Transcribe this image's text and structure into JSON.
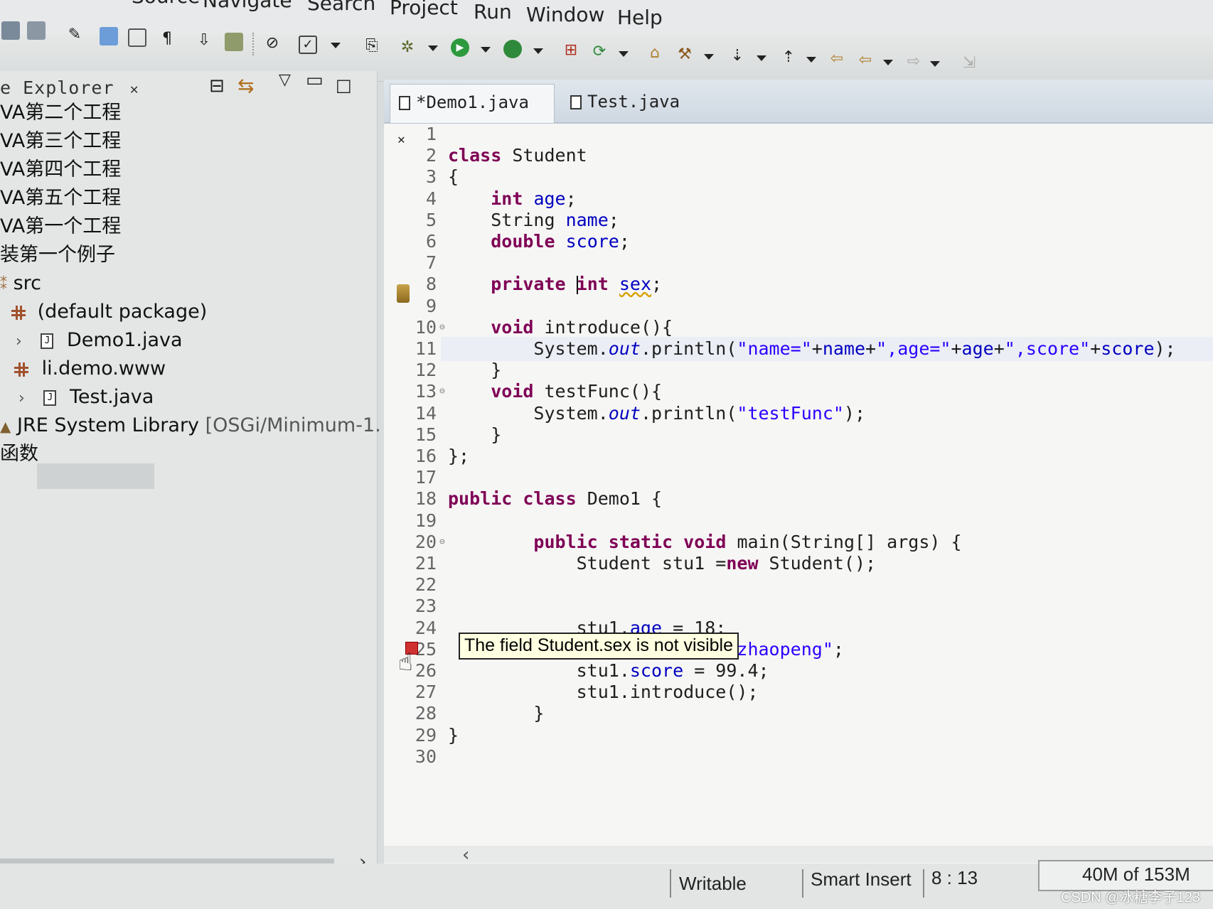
{
  "menu": {
    "items": [
      "Source",
      "Navigate",
      "Search",
      "Project",
      "Run",
      "Window",
      "Help"
    ]
  },
  "explorer": {
    "title": "e Explorer",
    "close_glyph": "✕",
    "tree": [
      {
        "label": "VA第二个工程",
        "level": 0,
        "icon": "project-icon"
      },
      {
        "label": "VA第三个工程",
        "level": 0,
        "icon": "project-icon"
      },
      {
        "label": "VA第四个工程",
        "level": 0,
        "icon": "project-icon"
      },
      {
        "label": "VA第五个工程",
        "level": 0,
        "icon": "project-icon"
      },
      {
        "label": "VA第一个工程",
        "level": 0,
        "icon": "project-icon"
      },
      {
        "label": "装第一个例子",
        "level": 0,
        "icon": "project-icon"
      },
      {
        "label": "src",
        "level": 0,
        "icon": "source-folder-icon"
      },
      {
        "label": "(default package)",
        "level": 1,
        "icon": "package-icon"
      },
      {
        "label": "Demo1.java",
        "level": 2,
        "icon": "java-file-icon"
      },
      {
        "label": "li.demo.www",
        "level": 1,
        "icon": "package-icon"
      },
      {
        "label": "Test.java",
        "level": 2,
        "icon": "java-file-icon",
        "selected": true
      },
      {
        "label": "JRE System Library",
        "suffix": "[OSGi/Minimum-1.",
        "level": 0,
        "icon": "library-icon"
      },
      {
        "label": "函数",
        "level": 0,
        "icon": "project-icon"
      }
    ]
  },
  "editor": {
    "tabs": [
      {
        "label": "*Demo1.java",
        "active": true
      },
      {
        "label": "Test.java",
        "active": false
      }
    ],
    "tooltip": "The field Student.sex is not visible",
    "lines": [
      {
        "n": "1",
        "fold": "",
        "code": ""
      },
      {
        "n": "2",
        "fold": "",
        "code": "class Student"
      },
      {
        "n": "3",
        "fold": "",
        "code": "{"
      },
      {
        "n": "4",
        "fold": "",
        "code": "    int age;"
      },
      {
        "n": "5",
        "fold": "",
        "code": "    String name;"
      },
      {
        "n": "6",
        "fold": "",
        "code": "    double score;"
      },
      {
        "n": "7",
        "fold": "",
        "code": ""
      },
      {
        "n": "8",
        "fold": "",
        "code": "    private int sex;"
      },
      {
        "n": "9",
        "fold": "",
        "code": ""
      },
      {
        "n": "10",
        "fold": "⊖",
        "code": "    void introduce(){"
      },
      {
        "n": "11",
        "fold": "",
        "code": "        System.out.println(\"name=\"+name+\",age=\"+age+\",score\"+score);"
      },
      {
        "n": "12",
        "fold": "",
        "code": "    }"
      },
      {
        "n": "13",
        "fold": "⊖",
        "code": "    void testFunc(){"
      },
      {
        "n": "14",
        "fold": "",
        "code": "        System.out.println(\"testFunc\");"
      },
      {
        "n": "15",
        "fold": "",
        "code": "    }"
      },
      {
        "n": "16",
        "fold": "",
        "code": "};"
      },
      {
        "n": "17",
        "fold": "",
        "code": ""
      },
      {
        "n": "18",
        "fold": "",
        "code": "public class Demo1 {"
      },
      {
        "n": "19",
        "fold": "",
        "code": ""
      },
      {
        "n": "20",
        "fold": "⊖",
        "code": "        public static void main(String[] args) {"
      },
      {
        "n": "21",
        "fold": "",
        "code": "            Student stu1 =new Student();"
      },
      {
        "n": "22",
        "fold": "",
        "code": ""
      },
      {
        "n": "23",
        "fold": "",
        "code": ""
      },
      {
        "n": "24",
        "fold": "",
        "code": "            stu1.age = 18;"
      },
      {
        "n": "25",
        "fold": "",
        "code": "            stu1.name = \"lizhaopeng\";"
      },
      {
        "n": "26",
        "fold": "",
        "code": "            stu1.score = 99.4;"
      },
      {
        "n": "27",
        "fold": "",
        "code": "            stu1.introduce();"
      },
      {
        "n": "28",
        "fold": "",
        "code": "        }"
      },
      {
        "n": "29",
        "fold": "",
        "code": "}"
      },
      {
        "n": "30",
        "fold": "",
        "code": ""
      }
    ]
  },
  "status": {
    "writable": "Writable",
    "insert_mode": "Smart Insert",
    "position": "8 : 13",
    "memory": "40M of 153M"
  },
  "watermark": "CSDN @冰糖李子123"
}
